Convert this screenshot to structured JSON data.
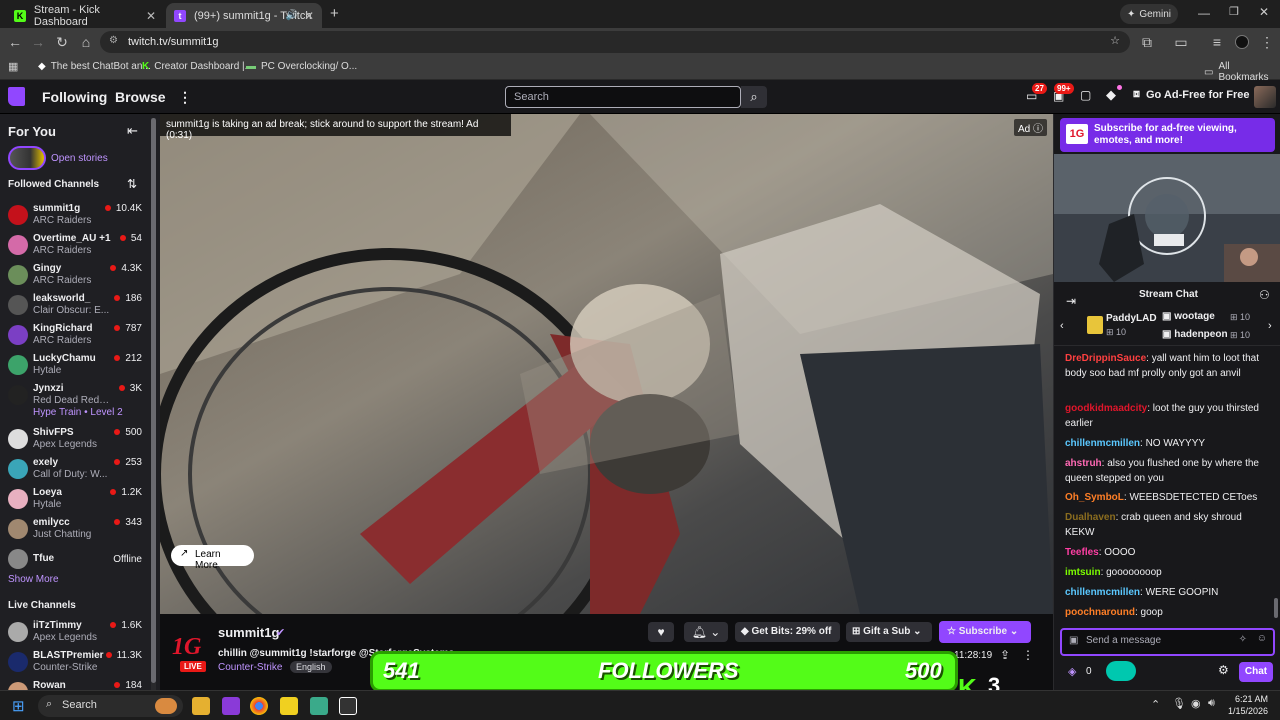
{
  "browser": {
    "tabs": [
      {
        "title": "Stream - Kick Dashboard"
      },
      {
        "title": "(99+) summit1g - Twitch"
      }
    ],
    "gemini_label": "Gemini",
    "url": "twitch.tv/summit1g",
    "bookmarks": [
      "The best ChatBot an...",
      "Creator Dashboard |...",
      "PC Overclocking/ O..."
    ],
    "all_bookmarks": "All Bookmarks"
  },
  "twitch_nav": {
    "following": "Following",
    "browse": "Browse",
    "search_placeholder": "Search",
    "inbox_badge": "27",
    "notif_badge": "99+",
    "ad_free": "Go Ad-Free for Free"
  },
  "sidebar": {
    "for_you": "For You",
    "open_stories": "Open stories",
    "followed_title": "Followed Channels",
    "channels": [
      {
        "name": "summit1g",
        "game": "ARC Raiders",
        "viewers": "10.4K",
        "color": "#c4111b"
      },
      {
        "name": "Overtime_AU +1",
        "game": "ARC Raiders",
        "viewers": "54",
        "color": "#d46aa8"
      },
      {
        "name": "Gingy",
        "game": "ARC Raiders",
        "viewers": "4.3K",
        "color": "#6b8e5a"
      },
      {
        "name": "leaksworld_",
        "game": "Clair Obscur: E...",
        "viewers": "186",
        "color": "#555"
      },
      {
        "name": "KingRichard",
        "game": "ARC Raiders",
        "viewers": "787",
        "color": "#7b3fc4"
      },
      {
        "name": "LuckyChamu",
        "game": "Hytale",
        "viewers": "212",
        "color": "#3ca36a"
      },
      {
        "name": "Jynxzi",
        "game": "Red Dead Rede...",
        "viewers": "3K",
        "color": "#222",
        "extra": "Hype Train • Level 2"
      },
      {
        "name": "ShivFPS",
        "game": "Apex Legends",
        "viewers": "500",
        "color": "#ddd"
      },
      {
        "name": "exely",
        "game": "Call of Duty: W...",
        "viewers": "253",
        "color": "#3aa5b8"
      },
      {
        "name": "Loeya",
        "game": "Hytale",
        "viewers": "1.2K",
        "color": "#e8b0c0"
      },
      {
        "name": "emilycc",
        "game": "Just Chatting",
        "viewers": "343",
        "color": "#a08870"
      },
      {
        "name": "Tfue",
        "game": "",
        "viewers": "Offline",
        "color": "#888"
      }
    ],
    "show_more": "Show More",
    "live_title": "Live Channels",
    "live": [
      {
        "name": "iiTzTimmy",
        "game": "Apex Legends",
        "viewers": "1.6K",
        "color": "#aaa"
      },
      {
        "name": "BLASTPremier",
        "game": "Counter-Strike",
        "viewers": "11.3K",
        "color": "#1a2a6c"
      },
      {
        "name": "Rowan",
        "game": "",
        "viewers": "184",
        "color": "#c97"
      }
    ]
  },
  "video": {
    "ad_message": "summit1g is taking an ad break; stick around to support the stream! Ad (0:31)",
    "ad_label": "Ad",
    "learn_more": "Learn More"
  },
  "stream_info": {
    "channel": "summit1g",
    "live": "LIVE",
    "title": "chillin @summit1g !starforge @StarforgeSystems",
    "category": "Counter-Strike",
    "tag": "English",
    "get_bits": "Get Bits: 29% off",
    "gift_sub": "Gift a Sub",
    "subscribe": "Subscribe",
    "uptime": "11:28:19"
  },
  "chat": {
    "sub_banner": "Subscribe for ad-free viewing, emotes, and more!",
    "title": "Stream Chat",
    "leaders": [
      {
        "name": "PaddyLAD",
        "count": "10"
      },
      {
        "name": "wootage",
        "count": "10"
      },
      {
        "name": "hadenpeon",
        "count": "10"
      }
    ],
    "messages": [
      {
        "user": "DreDrippinSauce",
        "text": ": yall want him to loot that body soo bad mf prolly only got an anvil",
        "color": "#ff4040"
      },
      {
        "user": "goodkidmaadcity",
        "text": ": loot the guy you thirsted earlier",
        "color": "#e0162b"
      },
      {
        "user": "chillenmcmillen",
        "text": ": NO WAYYYY",
        "color": "#5bc8ff"
      },
      {
        "user": "ahstruh",
        "text": ": also you flushed one by where the queen stepped on you",
        "color": "#ff69b4"
      },
      {
        "user": "Oh_SymboL",
        "text": ": WEEBSDETECTED CEToes",
        "color": "#ff7f27"
      },
      {
        "user": "Dualhaven",
        "text": ": crab queen and sky shroud KEKW",
        "color": "#8b6d1f"
      },
      {
        "user": "Teefles",
        "text": ": OOOO",
        "color": "#ff3fa4"
      },
      {
        "user": "imtsuin",
        "text": ": goooooooop",
        "color": "#7cfc00"
      },
      {
        "user": "chillenmcmillen",
        "text": ": WERE GOOPIN",
        "color": "#5bc8ff"
      },
      {
        "user": "poochnaround",
        "text": ": goop",
        "color": "#ff7f27"
      }
    ],
    "input_placeholder": "Send a message",
    "points": "0",
    "chat_button": "Chat"
  },
  "followers_overlay": {
    "current": "541",
    "label": "FOLLOWERS",
    "goal": "500",
    "kick_count": "3"
  },
  "taskbar": {
    "search": "Search",
    "time": "6:21 AM",
    "date": "1/15/2026"
  }
}
